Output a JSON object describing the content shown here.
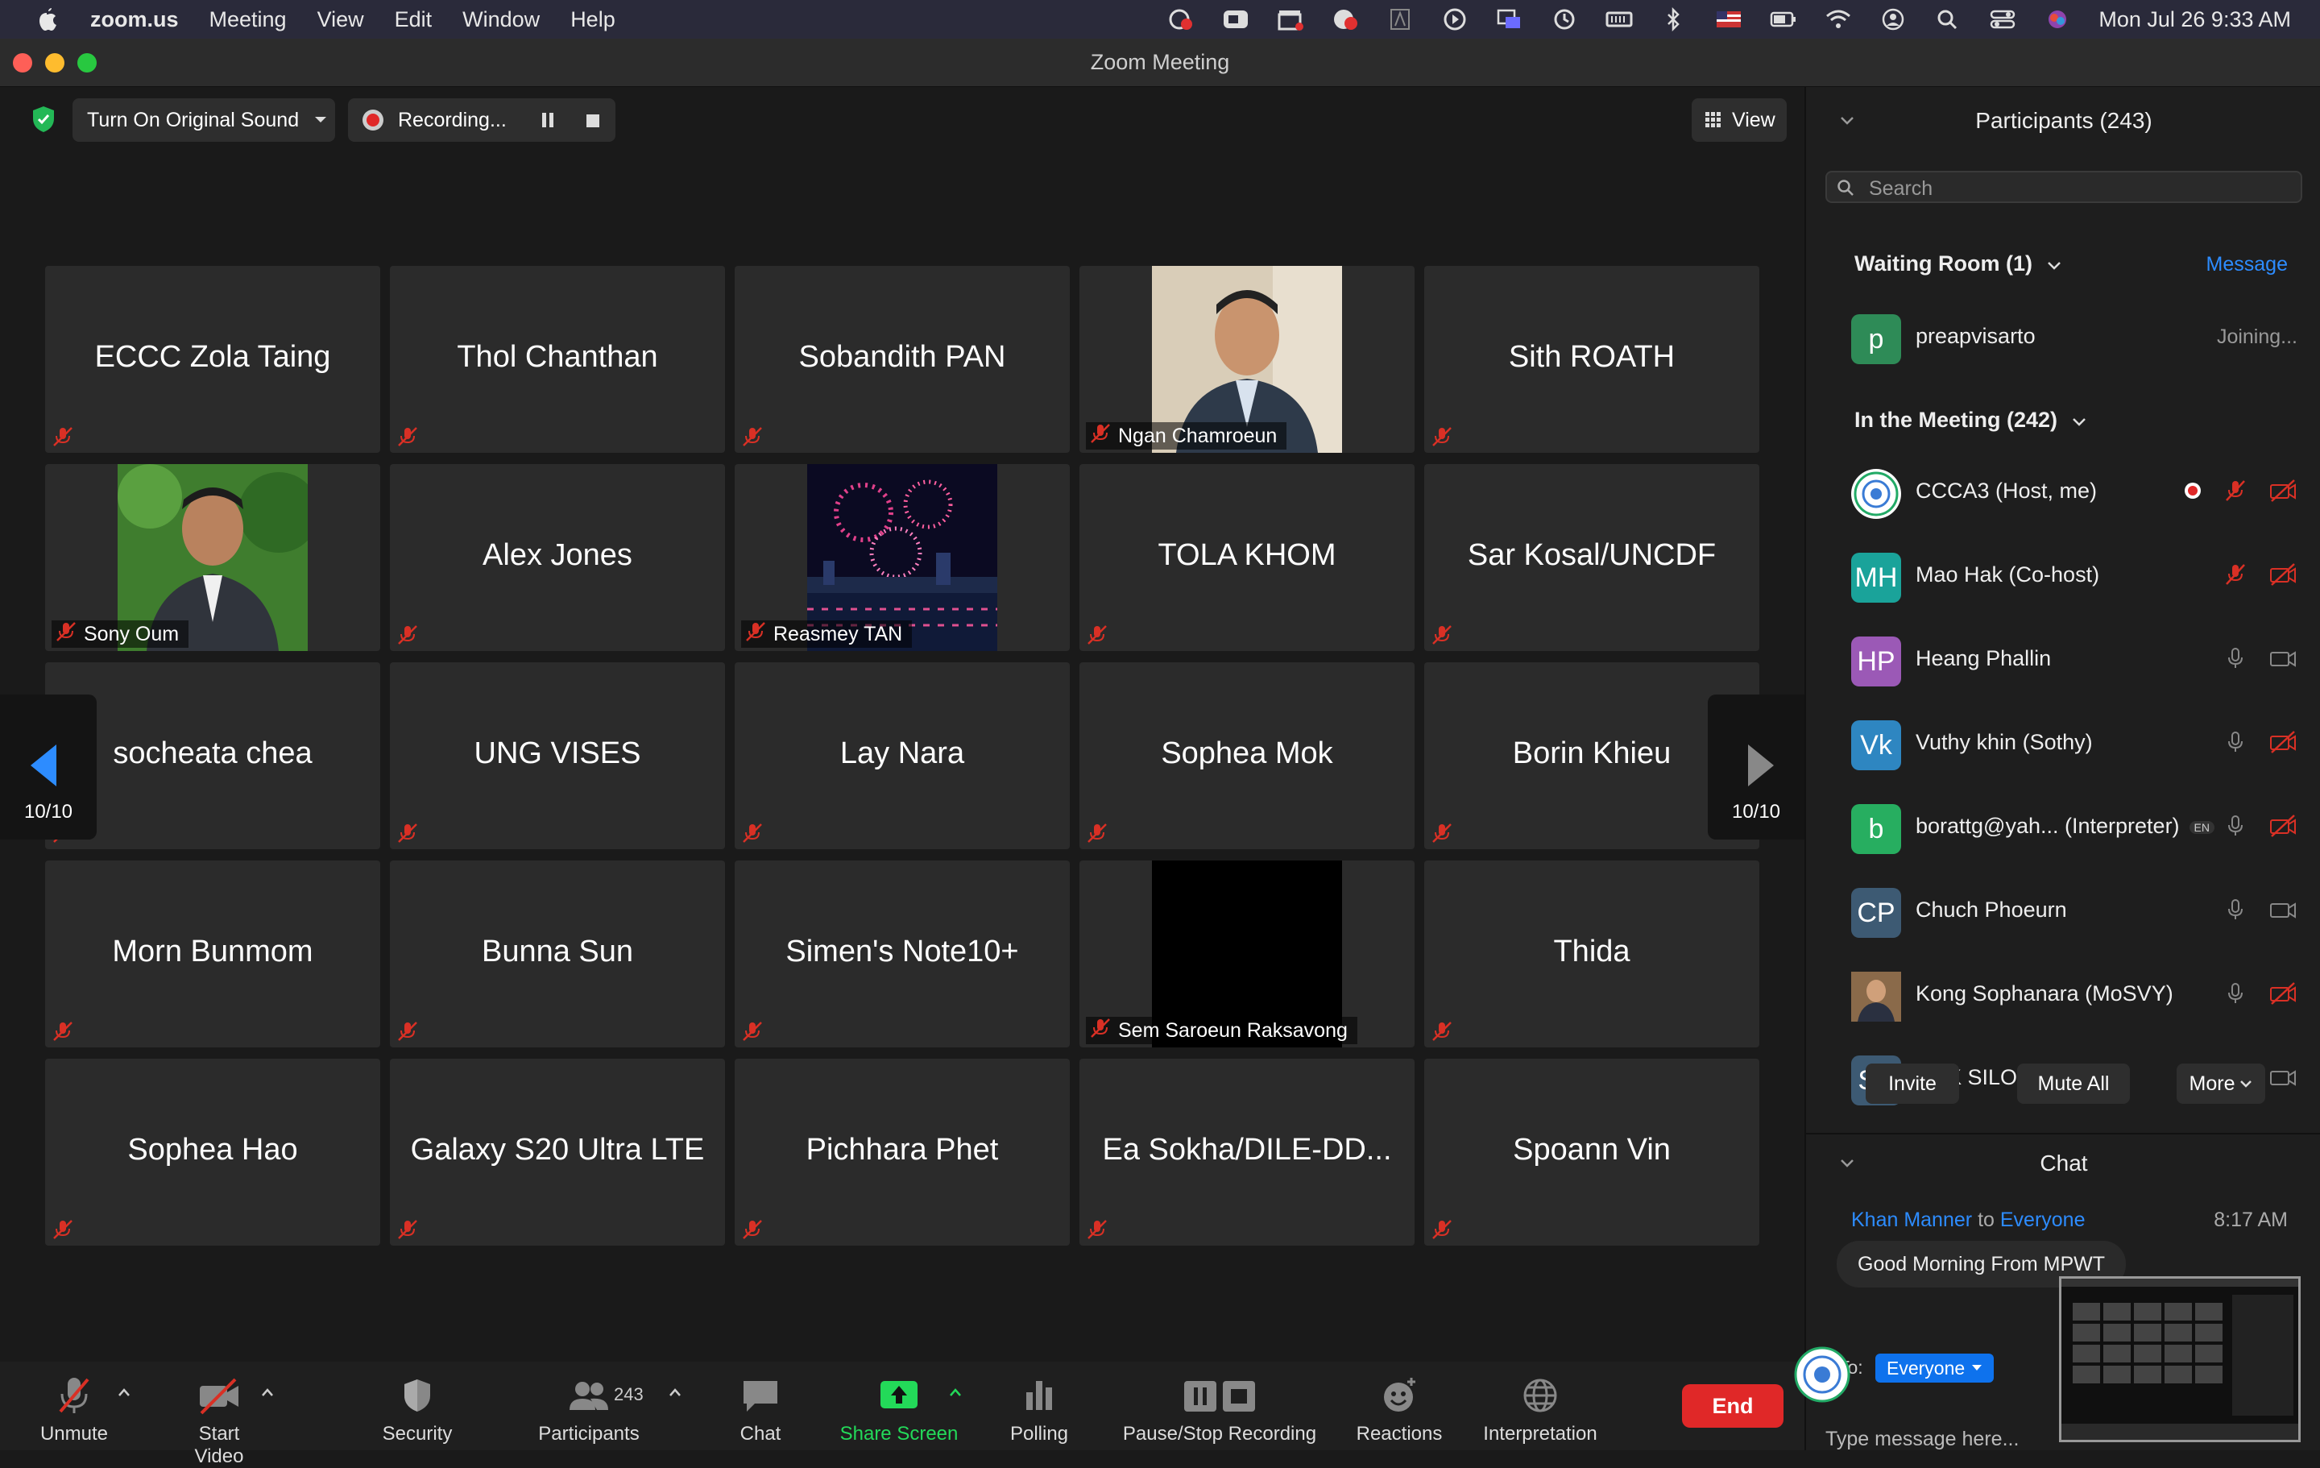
{
  "menubar": {
    "app": "zoom.us",
    "items": [
      "Meeting",
      "View",
      "Edit",
      "Window",
      "Help"
    ],
    "clock": "Mon Jul 26  9:33 AM"
  },
  "window": {
    "title": "Zoom Meeting"
  },
  "topbar": {
    "original_sound": "Turn On Original Sound",
    "recording": "Recording...",
    "view": "View"
  },
  "grid": {
    "page_left": "10/10",
    "page_right": "10/10",
    "tiles": [
      {
        "name": "ECCC Zola Taing"
      },
      {
        "name": "Thol Chanthan"
      },
      {
        "name": "Sobandith PAN"
      },
      {
        "name": "Ngan Chamroeun",
        "video": "man-suit"
      },
      {
        "name": "Sith ROATH"
      },
      {
        "name": "Sony Oum",
        "video": "man-garden"
      },
      {
        "name": "Alex Jones"
      },
      {
        "name": "Reasmey TAN",
        "video": "fireworks"
      },
      {
        "name": "TOLA KHOM"
      },
      {
        "name": "Sar Kosal/UNCDF"
      },
      {
        "name": "socheata chea"
      },
      {
        "name": "UNG VISES"
      },
      {
        "name": "Lay Nara"
      },
      {
        "name": "Sophea Mok"
      },
      {
        "name": "Borin Khieu"
      },
      {
        "name": "Morn Bunmom"
      },
      {
        "name": "Bunna Sun"
      },
      {
        "name": "Simen's Note10+"
      },
      {
        "name": "Sem Saroeun Raksavong",
        "video": "black"
      },
      {
        "name": "Thida"
      },
      {
        "name": "Sophea Hao"
      },
      {
        "name": "Galaxy S20 Ultra LTE"
      },
      {
        "name": "Pichhara Phet"
      },
      {
        "name": "Ea Sokha/DILE-DD..."
      },
      {
        "name": "Spoann Vin"
      }
    ]
  },
  "toolbar": {
    "unmute": "Unmute",
    "start_video": "Start Video",
    "security": "Security",
    "participants": "Participants",
    "participant_count": "243",
    "chat": "Chat",
    "share_screen": "Share Screen",
    "polling": "Polling",
    "recording": "Pause/Stop Recording",
    "reactions": "Reactions",
    "interpretation": "Interpretation",
    "end": "End"
  },
  "participants": {
    "header": "Participants (243)",
    "search_placeholder": "Search",
    "waiting_header": "Waiting Room (1)",
    "message": "Message",
    "waiting": [
      {
        "initial": "p",
        "name": "preapvisarto",
        "status": "Joining..."
      }
    ],
    "meeting_header": "In the Meeting (242)",
    "list": [
      {
        "initial": "",
        "name": "CCCA3 (Host, me)",
        "color": "#ffffff"
      },
      {
        "initial": "MH",
        "name": "Mao Hak (Co-host)",
        "color": "#1aa39a"
      },
      {
        "initial": "HP",
        "name": "Heang Phallin",
        "color": "#9b59b6"
      },
      {
        "initial": "Vk",
        "name": "Vuthy khin (Sothy)",
        "color": "#2e86c1"
      },
      {
        "initial": "b",
        "name": "borattg@yah... (Interpreter)",
        "badge": "EN",
        "color": "#27ae60"
      },
      {
        "initial": "CP",
        "name": "Chuch Phoeurn",
        "color": "#3d5a73"
      },
      {
        "initial": "",
        "name": "Kong Sophanara (MoSVY)",
        "color": "#7a5a3a"
      },
      {
        "initial": "SS",
        "name": "SOK SILO",
        "color": "#3d5a73"
      }
    ],
    "invite": "Invite",
    "mute_all": "Mute All",
    "more": "More"
  },
  "chat": {
    "header": "Chat",
    "sender": "Khan Manner",
    "to_word": "to",
    "recipient": "Everyone",
    "time": "8:17 AM",
    "message": "Good Morning From MPWT",
    "to_label": "To:",
    "to_value": "Everyone",
    "placeholder": "Type message here..."
  },
  "colors": {
    "accent": "#0e72ed",
    "link": "#2d8cff",
    "end": "#e02828",
    "mute_red": "#d93025",
    "share_green": "#23d959"
  }
}
